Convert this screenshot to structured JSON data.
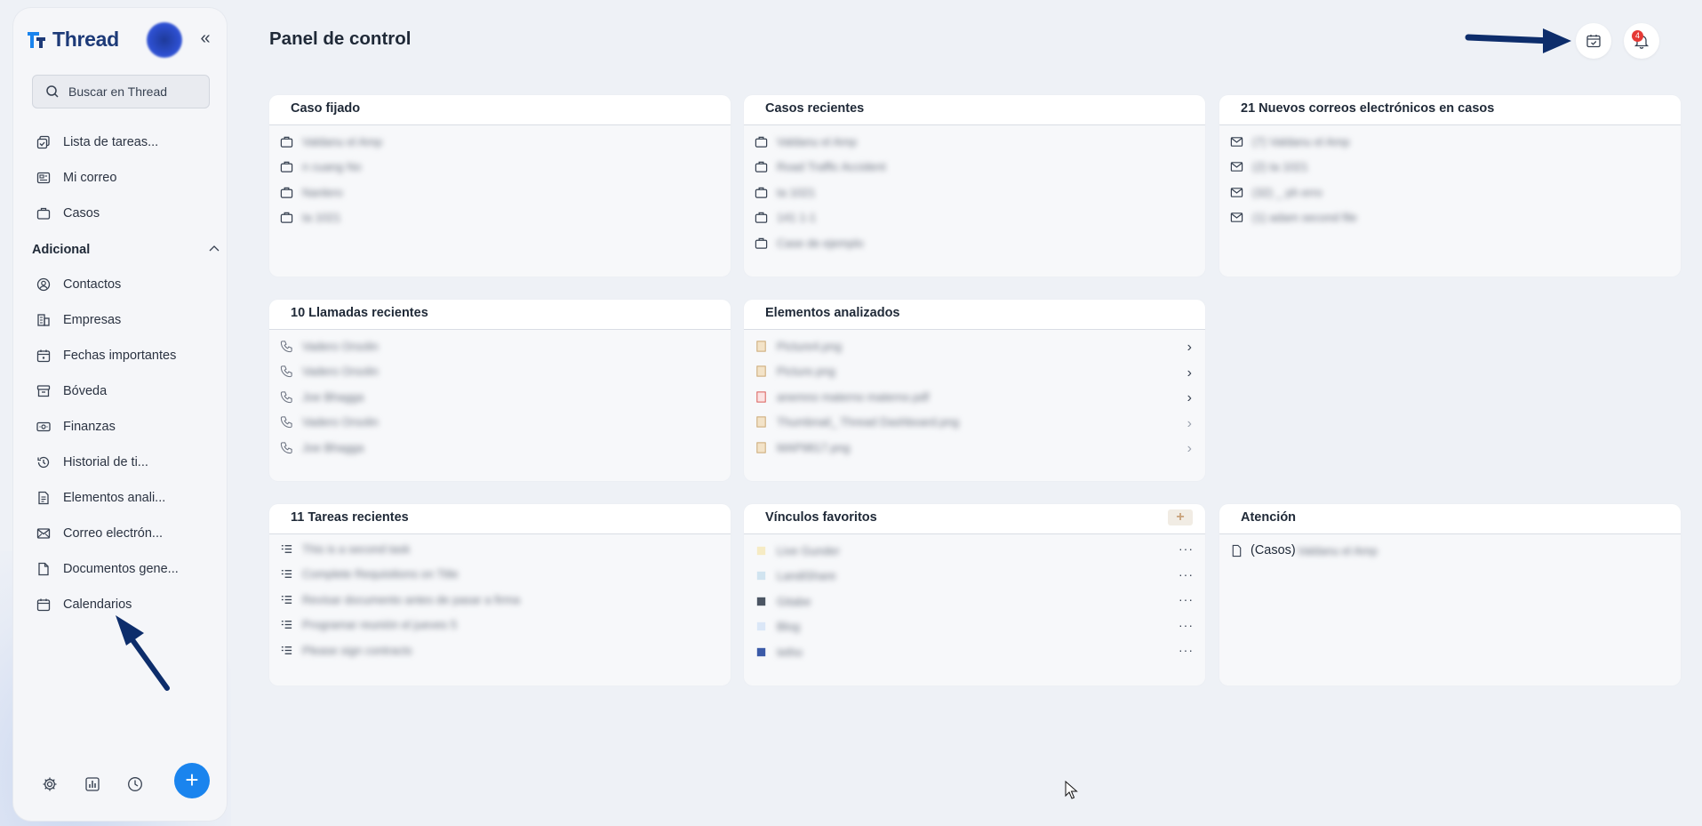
{
  "app": {
    "name": "Thread"
  },
  "sidebar": {
    "search_placeholder": "Buscar en Thread",
    "items": [
      {
        "label": "Lista de tareas...",
        "icon": "task-list-icon"
      },
      {
        "label": "Mi correo",
        "icon": "mail-icon"
      },
      {
        "label": "Casos",
        "icon": "briefcase-icon"
      }
    ],
    "section_label": "Adicional",
    "extra_items": [
      {
        "label": "Contactos",
        "icon": "contact-icon"
      },
      {
        "label": "Empresas",
        "icon": "building-icon"
      },
      {
        "label": "Fechas importantes",
        "icon": "calendar-icon"
      },
      {
        "label": "Bóveda",
        "icon": "archive-icon"
      },
      {
        "label": "Finanzas",
        "icon": "money-icon"
      },
      {
        "label": "Historial de ti...",
        "icon": "history-icon"
      },
      {
        "label": "Elementos anali...",
        "icon": "document-icon"
      },
      {
        "label": "Correo electrón...",
        "icon": "mail-icon"
      },
      {
        "label": "Documentos gene...",
        "icon": "file-icon"
      },
      {
        "label": "Calendarios",
        "icon": "calendar-icon"
      }
    ]
  },
  "header": {
    "title": "Panel de control",
    "notification_count": "4"
  },
  "cards": {
    "pinned": {
      "title": "Caso fijado",
      "rows": [
        "Valdanu el Amp",
        "n cuang No",
        "Nanlero",
        "ta 1021"
      ]
    },
    "recent_cases": {
      "title": "Casos recientes",
      "rows": [
        "Valdanu el Amp",
        "Road Traffic Accident",
        "ta 1021",
        "141 1-1",
        "Case de ejemplo"
      ]
    },
    "emails": {
      "title": "21 Nuevos correos electrónicos en casos",
      "rows": [
        "(7) Valdanu el Amp",
        "(2) ta 1021",
        "(32) _ ph erro",
        "(1) adam second file"
      ]
    },
    "calls": {
      "title": "10 Llamadas recientes",
      "rows": [
        "Vadero Orsolin",
        "Vadero Orsolin",
        "Joe Bhagga",
        "Vadero Orsolin",
        "Joe Bhagga"
      ]
    },
    "analyzed": {
      "title": "Elementos analizados",
      "rows": [
        "Picture4.png",
        "Picture.png",
        "anemno materno materno.pdf",
        "Thumbnail_ Thread Dashboard.png",
        "MAP9817.png"
      ]
    },
    "tasks": {
      "title": "11 Tareas recientes",
      "rows": [
        "This is a second task",
        "Complete Requisitions on Title",
        "Revisar documento antes de pasar a firma",
        "Programar reunión el jueves 5",
        "Please sign contracts"
      ]
    },
    "favorites": {
      "title": "Vínculos favoritos",
      "rows": [
        "Live Gunder",
        "LandiShare",
        "Gitabe",
        "Blog",
        "Ietho"
      ]
    },
    "attention": {
      "title": "Atención",
      "prefix": "(Casos)",
      "value": "Valdanu el Amp"
    }
  },
  "colors": {
    "accent": "#1a84ee",
    "brand": "#1d3a78",
    "arrow": "#0d2d6b",
    "badge": "#e53935"
  }
}
